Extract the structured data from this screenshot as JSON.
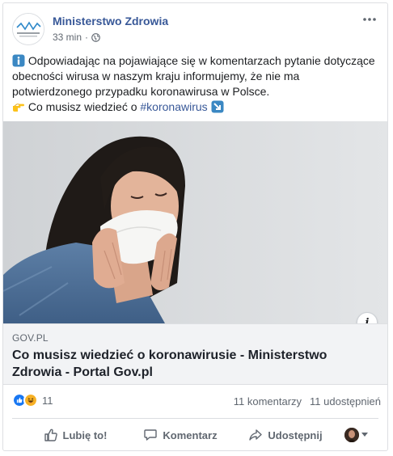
{
  "page": {
    "name": "Ministerstwo Zdrowia",
    "logo_text": "Ministerstwo Zdrowia",
    "timestamp": "33 min",
    "separator": "·",
    "audience_icon": "globe-icon"
  },
  "post": {
    "line1_prefix_icon": "info-icon",
    "text_main": "Odpowiadając na pojawiające się w komentarzach pytanie dotyczące obecności wirusa w naszym kraju informujemy, że nie ma potwierdzonego przypadku koronawirusa w Polsce.",
    "line2_prefix_icon": "pointing-hand-icon",
    "text_cta": "Co musisz wiedzieć o",
    "hashtag": "#koronawirus",
    "line2_suffix_icon": "arrow-down-right-icon"
  },
  "link": {
    "domain": "GOV.PL",
    "title": "Co musisz wiedzieć o koronawirusie - Ministerstwo Zdrowia - Portal Gov.pl",
    "info_badge": "i"
  },
  "stats": {
    "reactions": [
      "like-reaction-icon",
      "haha-reaction-icon"
    ],
    "reaction_count": "11",
    "comments": "11 komentarzy",
    "shares": "11 udostępnień"
  },
  "actions": {
    "like": "Lubię to!",
    "comment": "Komentarz",
    "share": "Udostępnij"
  },
  "colors": {
    "link_blue": "#385898",
    "like_blue": "#1877f2",
    "haha_yellow": "#f7b125"
  }
}
